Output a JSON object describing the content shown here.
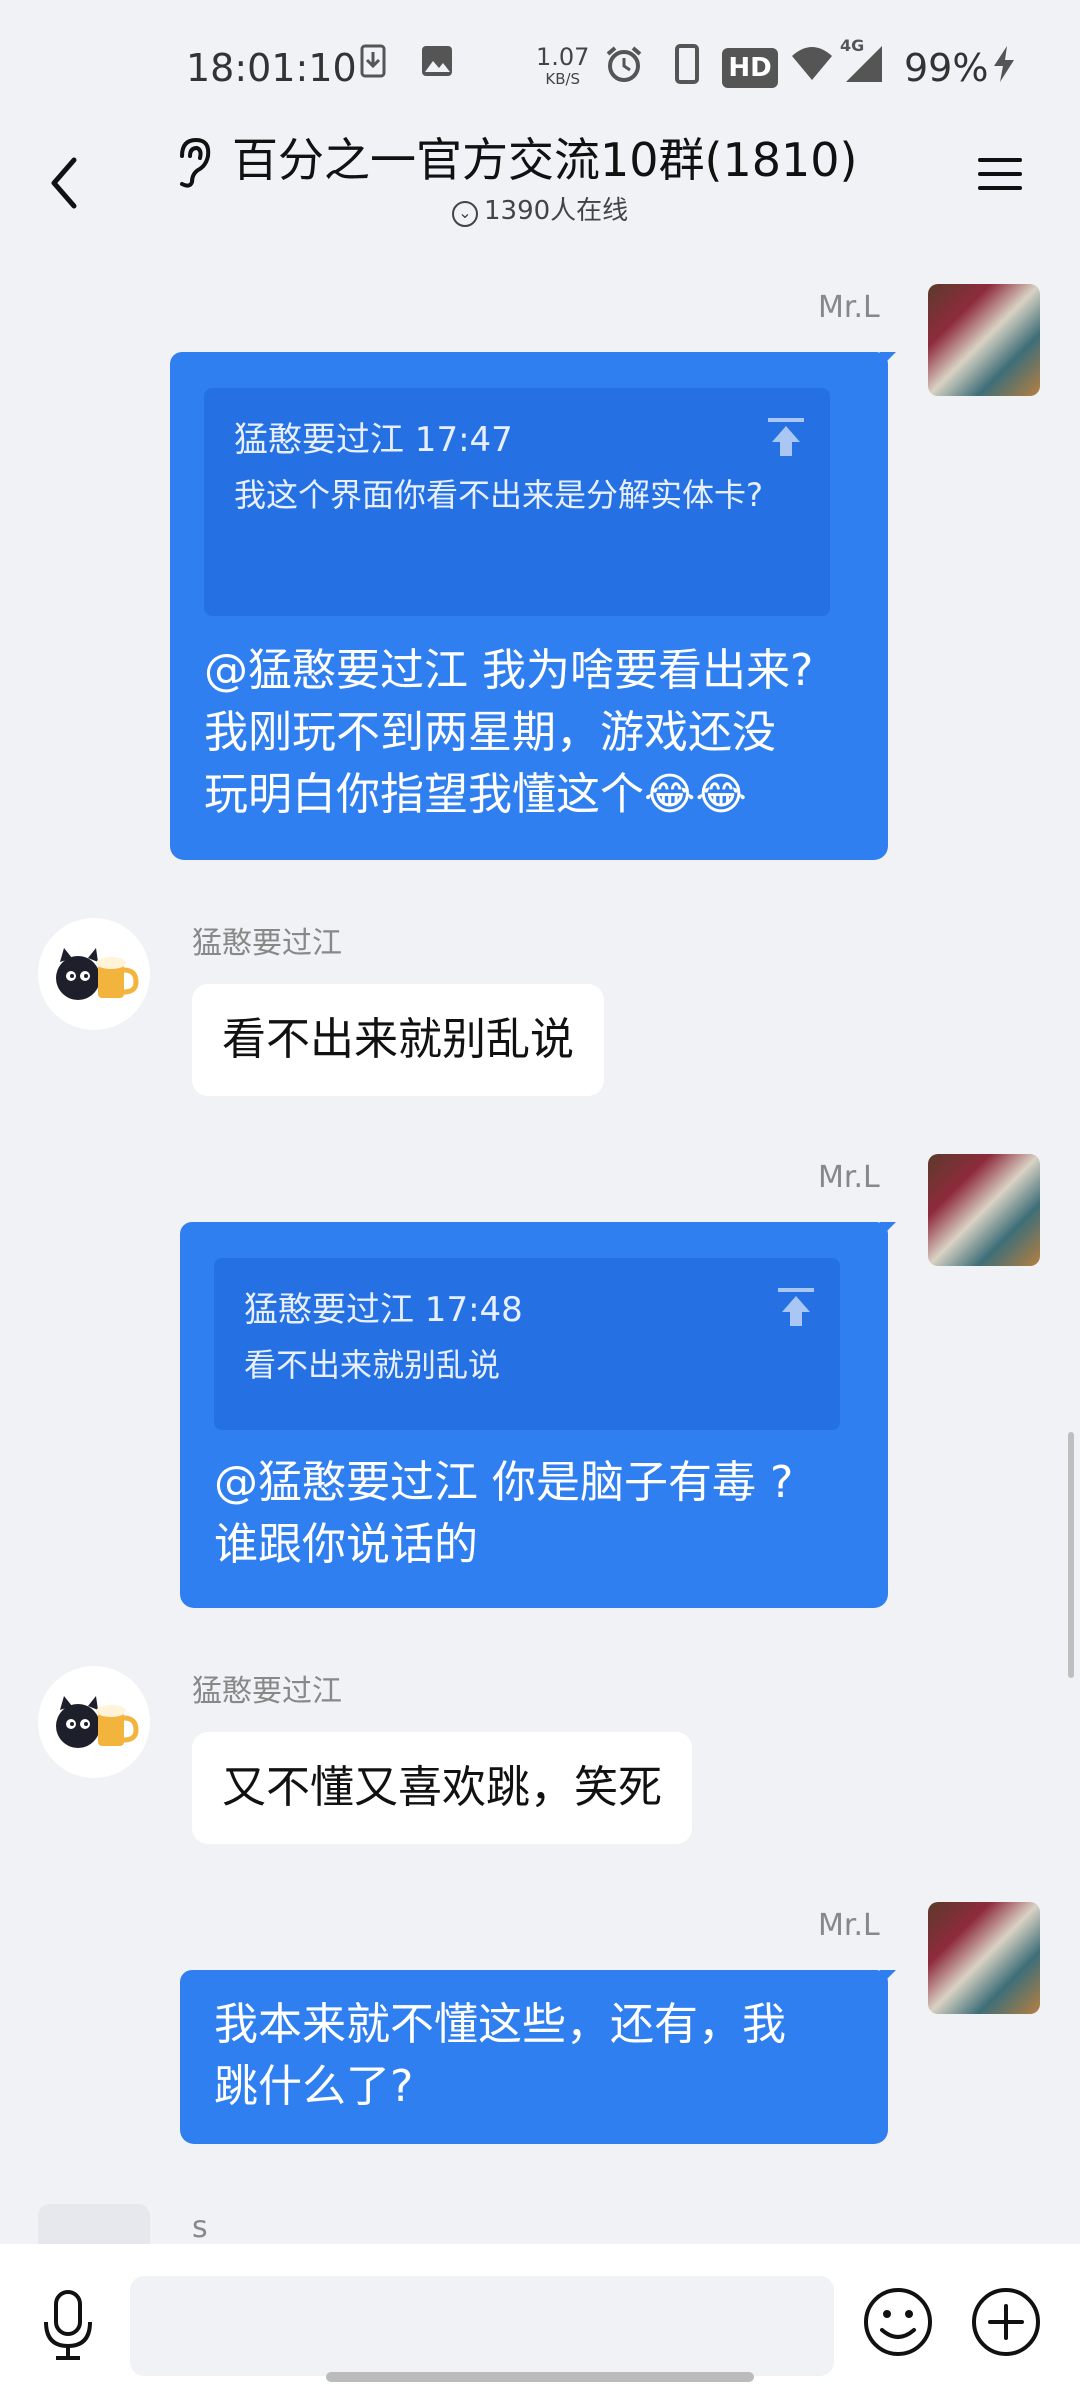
{
  "status_bar": {
    "time": "18:01:10",
    "net_speed_value": "1.07",
    "net_speed_unit": "KB/S",
    "hd_label": "HD",
    "network_label": "4G",
    "battery": "99%"
  },
  "header": {
    "title": "百分之一官方交流10群(1810)",
    "online_count": "1390人在线"
  },
  "messages": [
    {
      "sender": "Mr.L",
      "side": "right",
      "quote_header": "猛憨要过江 17:47",
      "quote_text": "我这个界面你看不出来是分解实体卡?",
      "text_line1": "@猛憨要过江 我为啥要看出来?",
      "text_line2": "我刚玩不到两星期，游戏还没",
      "text_line3": "玩明白你指望我懂这个😂😂"
    },
    {
      "sender": "猛憨要过江",
      "side": "left",
      "text": "看不出来就别乱说"
    },
    {
      "sender": "Mr.L",
      "side": "right",
      "quote_header": "猛憨要过江 17:48",
      "quote_text": "看不出来就别乱说",
      "text_line1": "@猛憨要过江 你是脑子有毒 ?",
      "text_line2": "谁跟你说话的"
    },
    {
      "sender": "猛憨要过江",
      "side": "left",
      "text": "又不懂又喜欢跳，笑死"
    },
    {
      "sender": "Mr.L",
      "side": "right",
      "text_line1": "我本来就不懂这些，还有，我",
      "text_line2": "跳什么了?"
    },
    {
      "sender": "s",
      "side": "left"
    }
  ],
  "colors": {
    "background": "#f1f2f6",
    "bubble_blue": "#2f7ff0",
    "quote_blue": "#2571e4"
  },
  "icons": [
    "back-icon",
    "ear-icon",
    "menu-icon",
    "mic-icon",
    "emoji-icon",
    "plus-icon"
  ]
}
